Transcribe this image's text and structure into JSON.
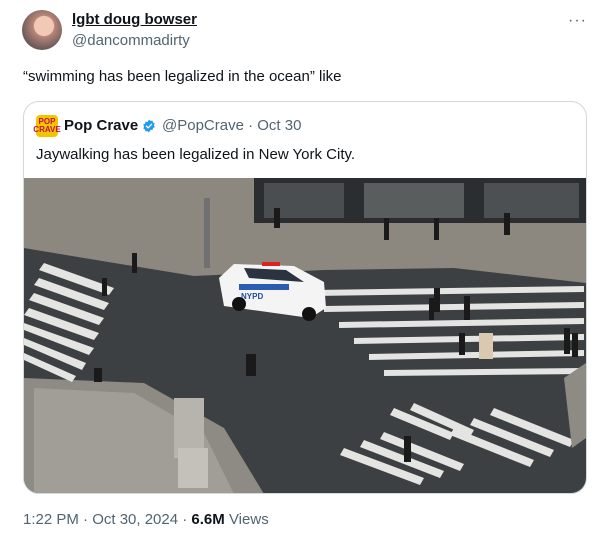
{
  "author": {
    "display_name": "lgbt doug bowser",
    "handle": "@dancommadirty"
  },
  "tweet": {
    "text": "“swimming has been legalized in the ocean” like"
  },
  "quoted": {
    "logo_text": "POP CRAVE",
    "display_name": "Pop Crave",
    "handle_and_date": "@PopCrave · Oct 30",
    "text": "Jaywalking has been legalized in New York City.",
    "photo_police_car_text": "NYPD"
  },
  "footer": {
    "timestamp": "1:22 PM · Oct 30, 2024 · ",
    "views_count": "6.6M",
    "views_label": " Views"
  },
  "icons": [
    "more-icon",
    "verified-badge-icon"
  ],
  "colors": {
    "text": "#0f1419",
    "secondary": "#536471",
    "border": "#cfd9de",
    "verified": "#1d9bf0"
  }
}
